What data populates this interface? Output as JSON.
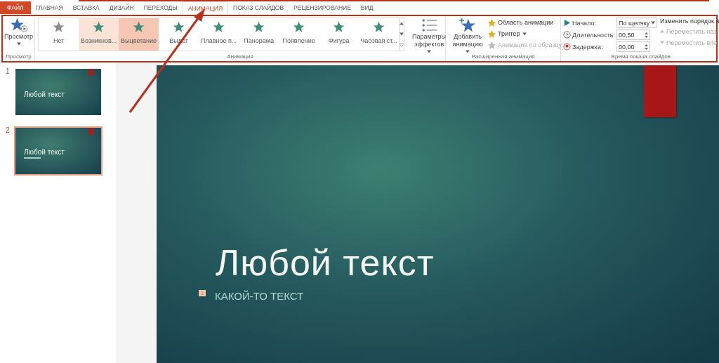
{
  "tabs": [
    {
      "label": "ФАЙЛ",
      "kind": "file",
      "selected": false
    },
    {
      "label": "ГЛАВНАЯ",
      "kind": "tab",
      "selected": false
    },
    {
      "label": "ВСТАВКА",
      "kind": "tab",
      "selected": false
    },
    {
      "label": "ДИЗАЙН",
      "kind": "tab",
      "selected": false
    },
    {
      "label": "ПЕРЕХОДЫ",
      "kind": "tab",
      "selected": false
    },
    {
      "label": "АНИМАЦИЯ",
      "kind": "tab",
      "selected": true
    },
    {
      "label": "ПОКАЗ СЛАЙДОВ",
      "kind": "tab",
      "selected": false
    },
    {
      "label": "РЕЦЕНЗИРОВАНИЕ",
      "kind": "tab",
      "selected": false
    },
    {
      "label": "ВИД",
      "kind": "tab",
      "selected": false
    }
  ],
  "preview_group": {
    "button": "Просмотр",
    "label": "Просмотр"
  },
  "animation_group": {
    "label": "Анимация",
    "effects": [
      {
        "label": "Нет",
        "kind": "none",
        "selected": false,
        "hovered": false
      },
      {
        "label": "Возникнов...",
        "kind": "effect",
        "selected": false,
        "hovered": true
      },
      {
        "label": "Выцветание",
        "kind": "effect",
        "selected": true,
        "hovered": false
      },
      {
        "label": "Вылет",
        "kind": "effect",
        "selected": false,
        "hovered": false
      },
      {
        "label": "Плавное п...",
        "kind": "effect",
        "selected": false,
        "hovered": false
      },
      {
        "label": "Панорама",
        "kind": "effect",
        "selected": false,
        "hovered": false
      },
      {
        "label": "Появление",
        "kind": "effect",
        "selected": false,
        "hovered": false
      },
      {
        "label": "Фигура",
        "kind": "effect",
        "selected": false,
        "hovered": false
      },
      {
        "label": "Часовая ст...",
        "kind": "effect",
        "selected": false,
        "hovered": false
      }
    ],
    "effect_options": "Параметры эффектов"
  },
  "advanced_group": {
    "label": "Расширенная анимация",
    "add_button": "Добавить анимацию",
    "items": [
      {
        "label": "Область анимации",
        "disabled": false,
        "dropdown": false
      },
      {
        "label": "Триггер",
        "disabled": false,
        "dropdown": true
      },
      {
        "label": "Анимация по образцу",
        "disabled": true,
        "dropdown": false
      }
    ]
  },
  "timing_group": {
    "label": "Время показа слайдов",
    "start": {
      "label": "Начало:",
      "value": "По щелчку"
    },
    "duration": {
      "label": "Длительность:",
      "value": "00,50"
    },
    "delay": {
      "label": "Задержка:",
      "value": "00,00"
    },
    "reorder": {
      "title": "Изменить порядок а",
      "items": [
        {
          "label": "Переместить наз",
          "disabled": true
        },
        {
          "label": "Переместить впе",
          "disabled": true
        }
      ]
    }
  },
  "thumbnails": [
    {
      "number": "1",
      "title": "Любой текст",
      "subtitle": false,
      "selected": false
    },
    {
      "number": "2",
      "title": "Любой текст",
      "subtitle": true,
      "selected": true
    }
  ],
  "slide": {
    "title": "Любой текст",
    "animation_tag": "1",
    "subtitle": "КАКОЙ-ТО ТЕКСТ"
  }
}
